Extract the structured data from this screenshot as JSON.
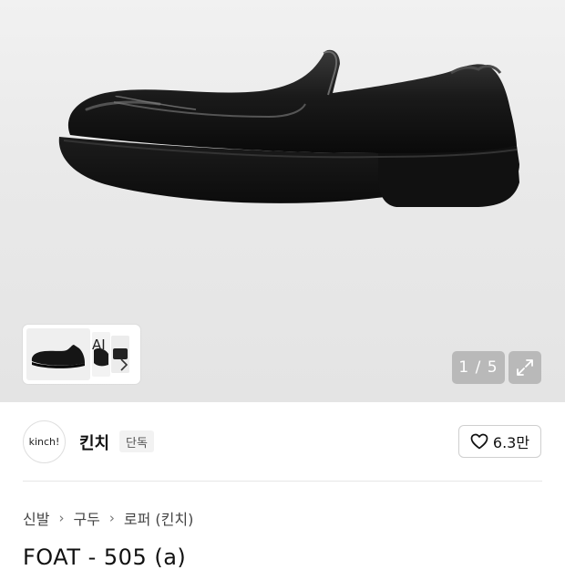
{
  "gallery": {
    "ai_label": "AI",
    "counter": "1 / 5",
    "colors": {
      "background": "#ebebeb",
      "overlay": "#969696"
    }
  },
  "brand": {
    "logo_text": "kinch!",
    "name": "킨치",
    "badge": "단독"
  },
  "like": {
    "count": "6.3만",
    "icon": "heart-outline-icon"
  },
  "breadcrumb": {
    "items": [
      "신발",
      "구두",
      "로퍼 (킨치)"
    ],
    "separator": "›"
  },
  "product": {
    "title": "FOAT - 505 (a)"
  }
}
